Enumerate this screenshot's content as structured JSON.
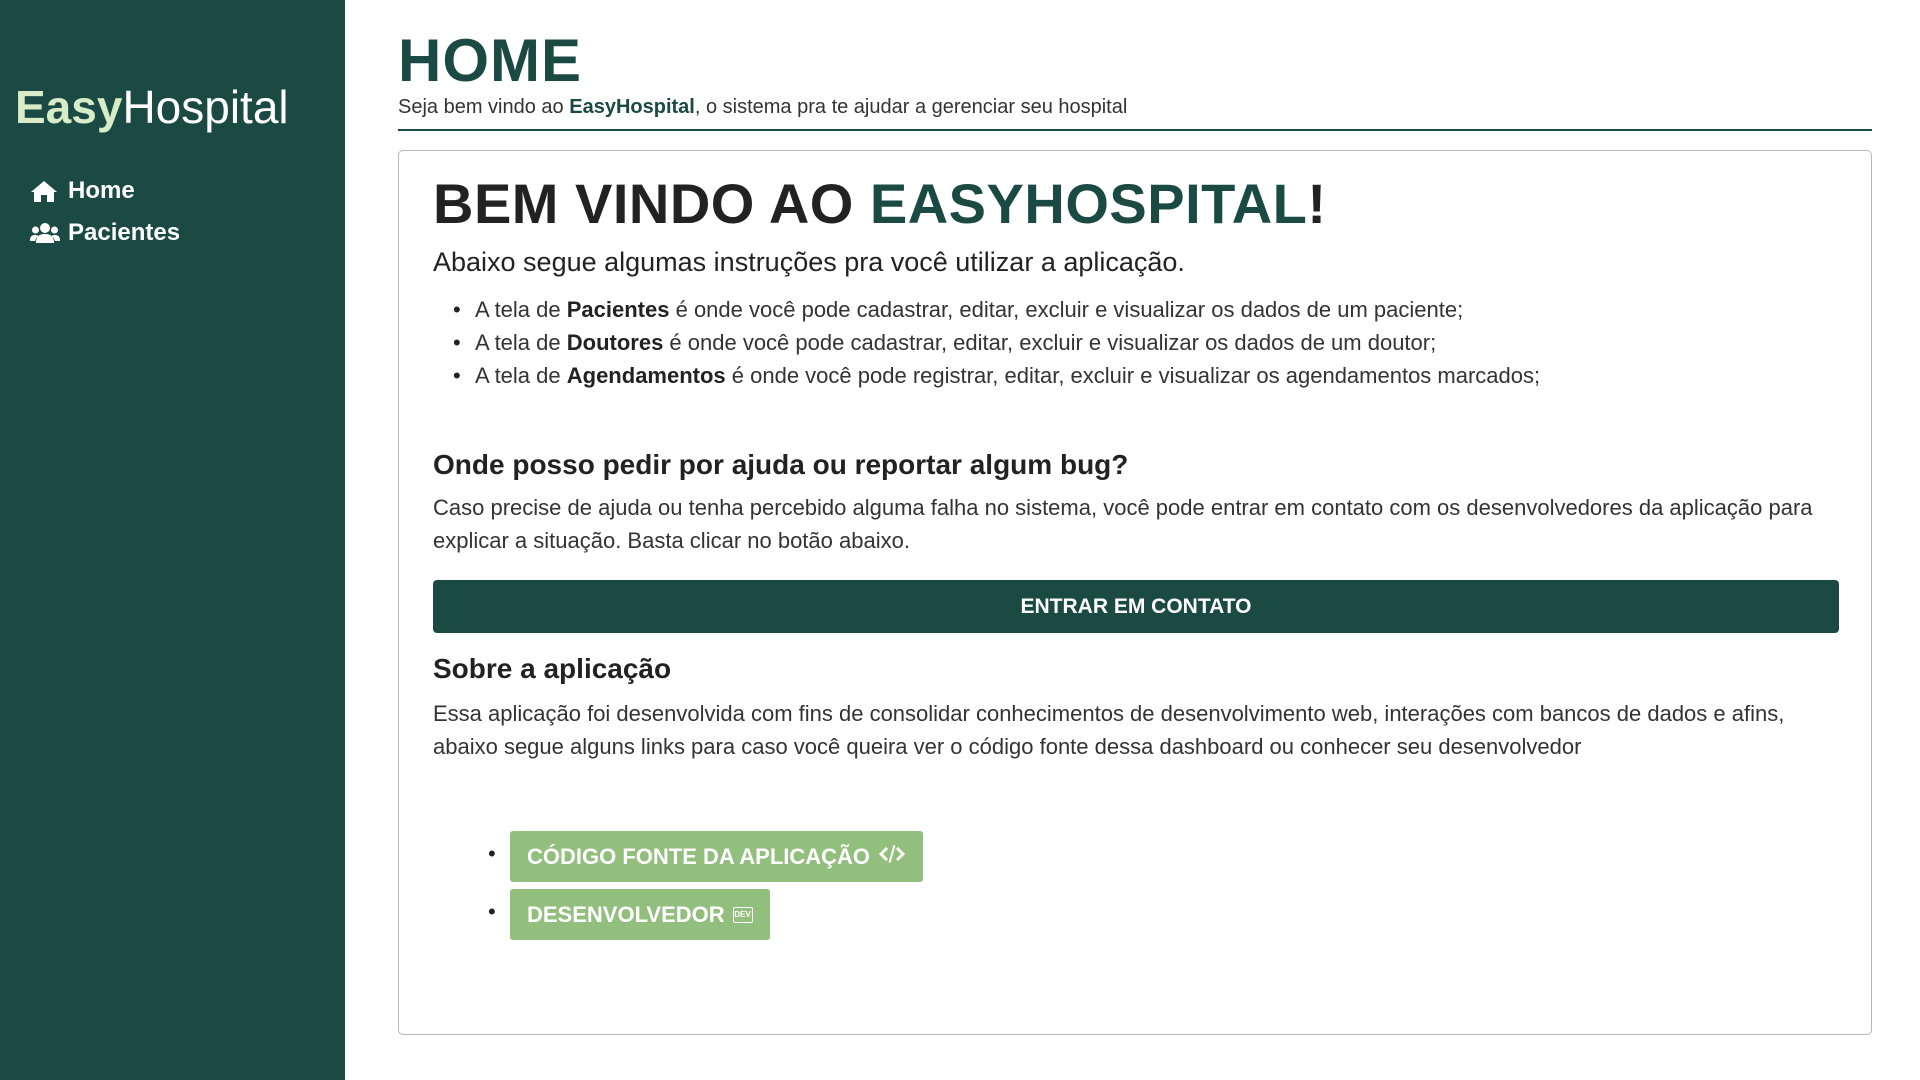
{
  "sidebar": {
    "brand_bold": "Easy",
    "brand_light": "Hospital",
    "items": [
      {
        "label": "Home",
        "icon": "home-icon"
      },
      {
        "label": "Pacientes",
        "icon": "users-icon"
      }
    ]
  },
  "header": {
    "title": "HOME",
    "subtitle_pre": "Seja bem vindo ao ",
    "subtitle_brand": "EasyHospital",
    "subtitle_post": ", o sistema pra te ajudar a gerenciar seu hospital"
  },
  "content": {
    "welcome_pre": "BEM VINDO AO ",
    "welcome_accent": "EASYHOSPITAL",
    "welcome_post": "!",
    "intro": "Abaixo segue algumas instruções pra você utilizar a aplicação.",
    "instructions": [
      {
        "pre": "A tela de ",
        "bold": "Pacientes",
        "post": " é onde você pode cadastrar, editar, excluir e visualizar os dados de um paciente;"
      },
      {
        "pre": "A tela de ",
        "bold": "Doutores",
        "post": " é onde você pode cadastrar, editar, excluir e visualizar os dados de um doutor;"
      },
      {
        "pre": "A tela de ",
        "bold": "Agendamentos",
        "post": " é onde você pode registrar, editar, excluir e visualizar os agendamentos marcados;"
      }
    ],
    "help_title": "Onde posso pedir por ajuda ou reportar algum bug?",
    "help_text": "Caso precise de ajuda ou tenha percebido alguma falha no sistema, você pode entrar em contato com os desenvolvedores da aplicação para explicar a situação. Basta clicar no botão abaixo.",
    "contact_label": "ENTRAR EM CONTATO",
    "about_title": "Sobre a aplicação",
    "about_text": "Essa aplicação foi desenvolvida com fins de consolidar conhecimentos de desenvolvimento web, interações com bancos de dados e afins, abaixo segue alguns links para caso você queira ver o código fonte dessa dashboard ou conhecer seu desenvolvedor",
    "links": [
      {
        "label": "CÓDIGO FONTE DA APLICAÇÃO",
        "icon": "code-icon"
      },
      {
        "label": "DESENVOLVEDOR",
        "icon": "dev-icon"
      }
    ]
  },
  "colors": {
    "sidebar_bg": "#1b4a45",
    "accent": "#1b4a45",
    "link_button": "#93bf7e",
    "brand_highlight": "#d8ecc8"
  }
}
